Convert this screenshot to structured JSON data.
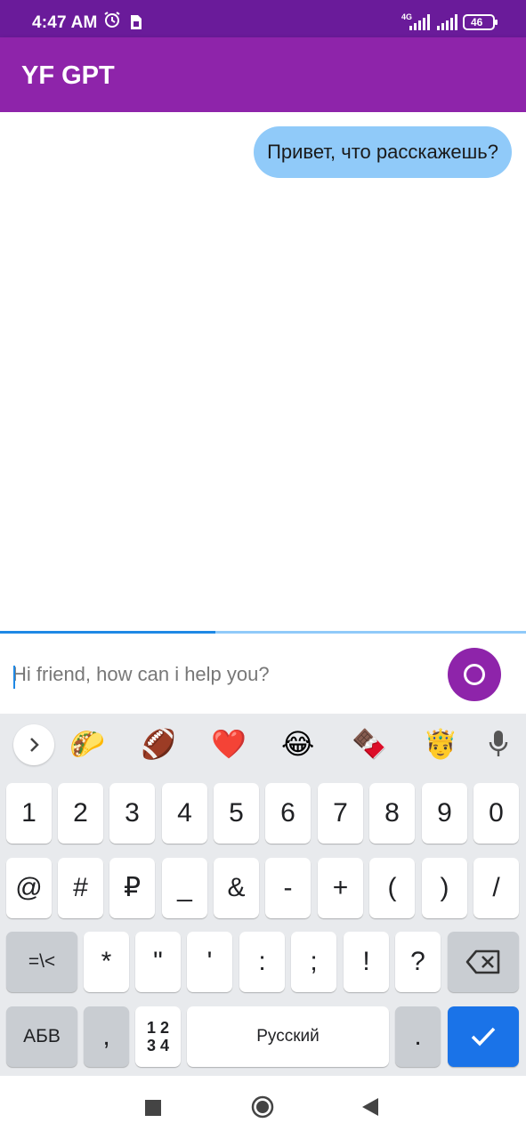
{
  "status_bar": {
    "time": "4:47 AM",
    "network": "4G",
    "battery": "46",
    "icons": [
      "alarm-icon",
      "sim-icon",
      "signal-icon",
      "signal-icon",
      "battery-icon"
    ]
  },
  "app_bar": {
    "title": "YF GPT"
  },
  "chat": {
    "messages": [
      {
        "from": "user",
        "text": "Привет, что расскажешь?"
      }
    ]
  },
  "progress": {
    "value": 0.41
  },
  "input": {
    "placeholder": "Hi friend, how can i help you?",
    "value": "",
    "record_icon": "record-icon"
  },
  "keyboard": {
    "suggestions": [
      "🌮",
      "🏈",
      "❤️",
      "😂",
      "🍫",
      "🤴"
    ],
    "row1": [
      "1",
      "2",
      "3",
      "4",
      "5",
      "6",
      "7",
      "8",
      "9",
      "0"
    ],
    "row2": [
      "@",
      "#",
      "₽",
      "_",
      "&",
      "-",
      "+",
      "(",
      ")",
      "/"
    ],
    "row3": [
      "=\\<",
      "*",
      "\"",
      "'",
      ":",
      ";",
      "!",
      "?"
    ],
    "row4": {
      "lang_switch": "АБВ",
      "comma": ",",
      "sym_page_top": "1 2",
      "sym_page_bottom": "3 4",
      "space": "Русский",
      "period": "."
    }
  },
  "colors": {
    "status_bar": "#6a1b9a",
    "app_bar": "#8e24aa",
    "bubble": "#90caf9",
    "accent": "#1a73e8"
  }
}
